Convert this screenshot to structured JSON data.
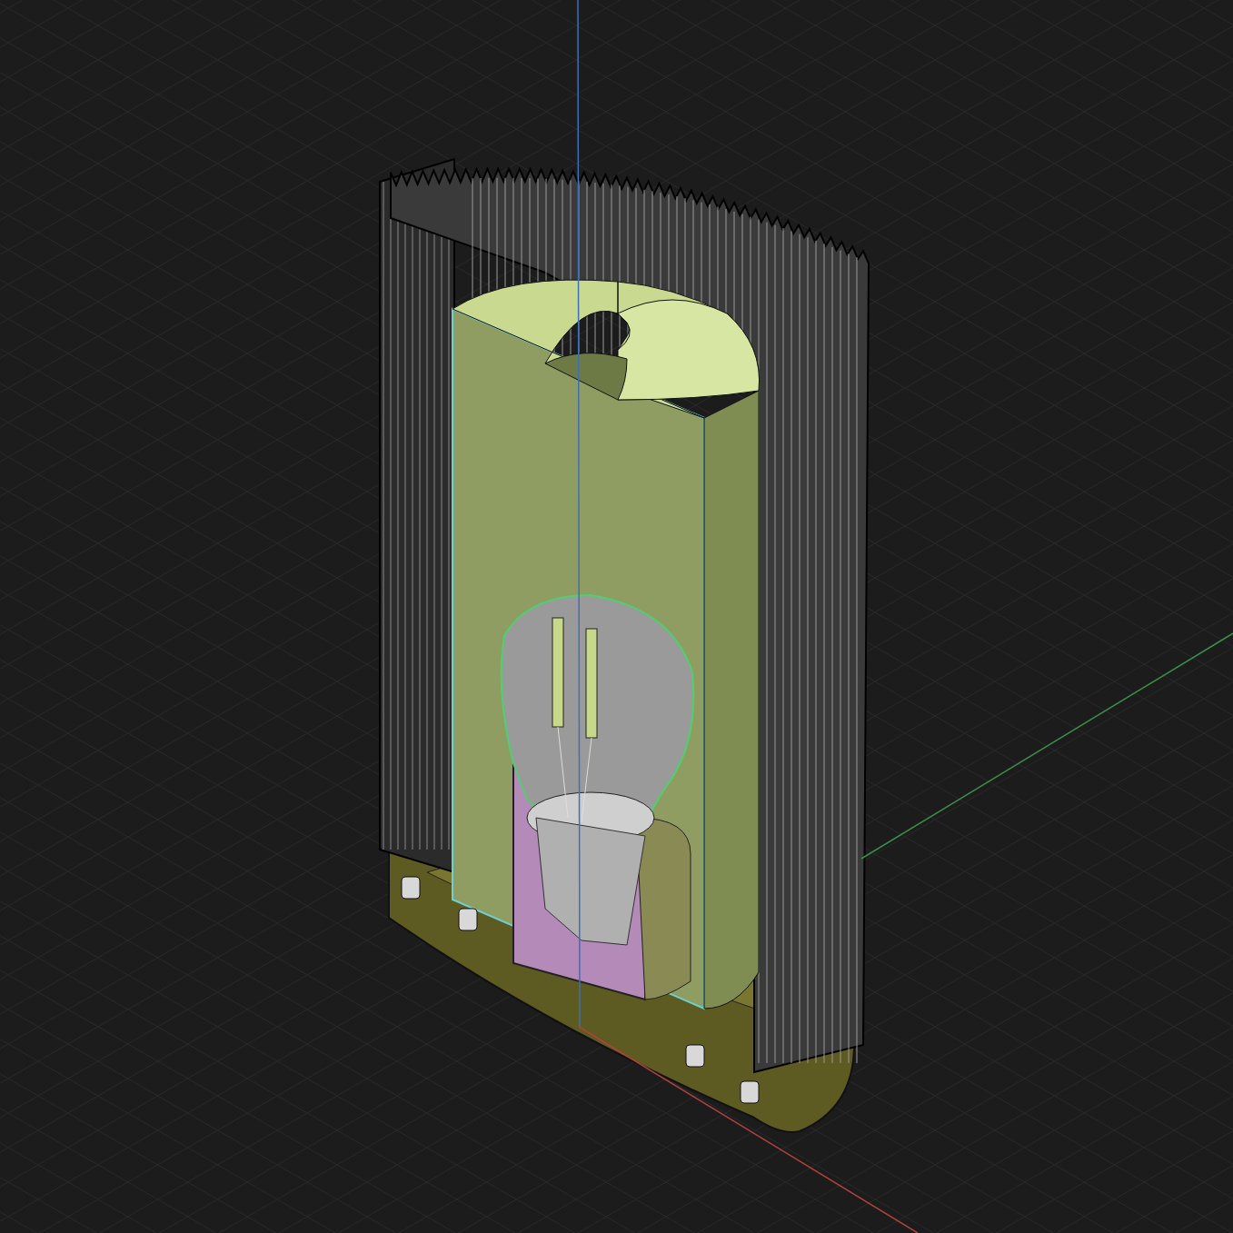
{
  "viewport": {
    "axes": [
      {
        "kind": "x",
        "color": "#b0413e"
      },
      {
        "kind": "y",
        "color": "#3c8f4a"
      },
      {
        "kind": "z",
        "color": "#3f6fb5"
      }
    ]
  }
}
